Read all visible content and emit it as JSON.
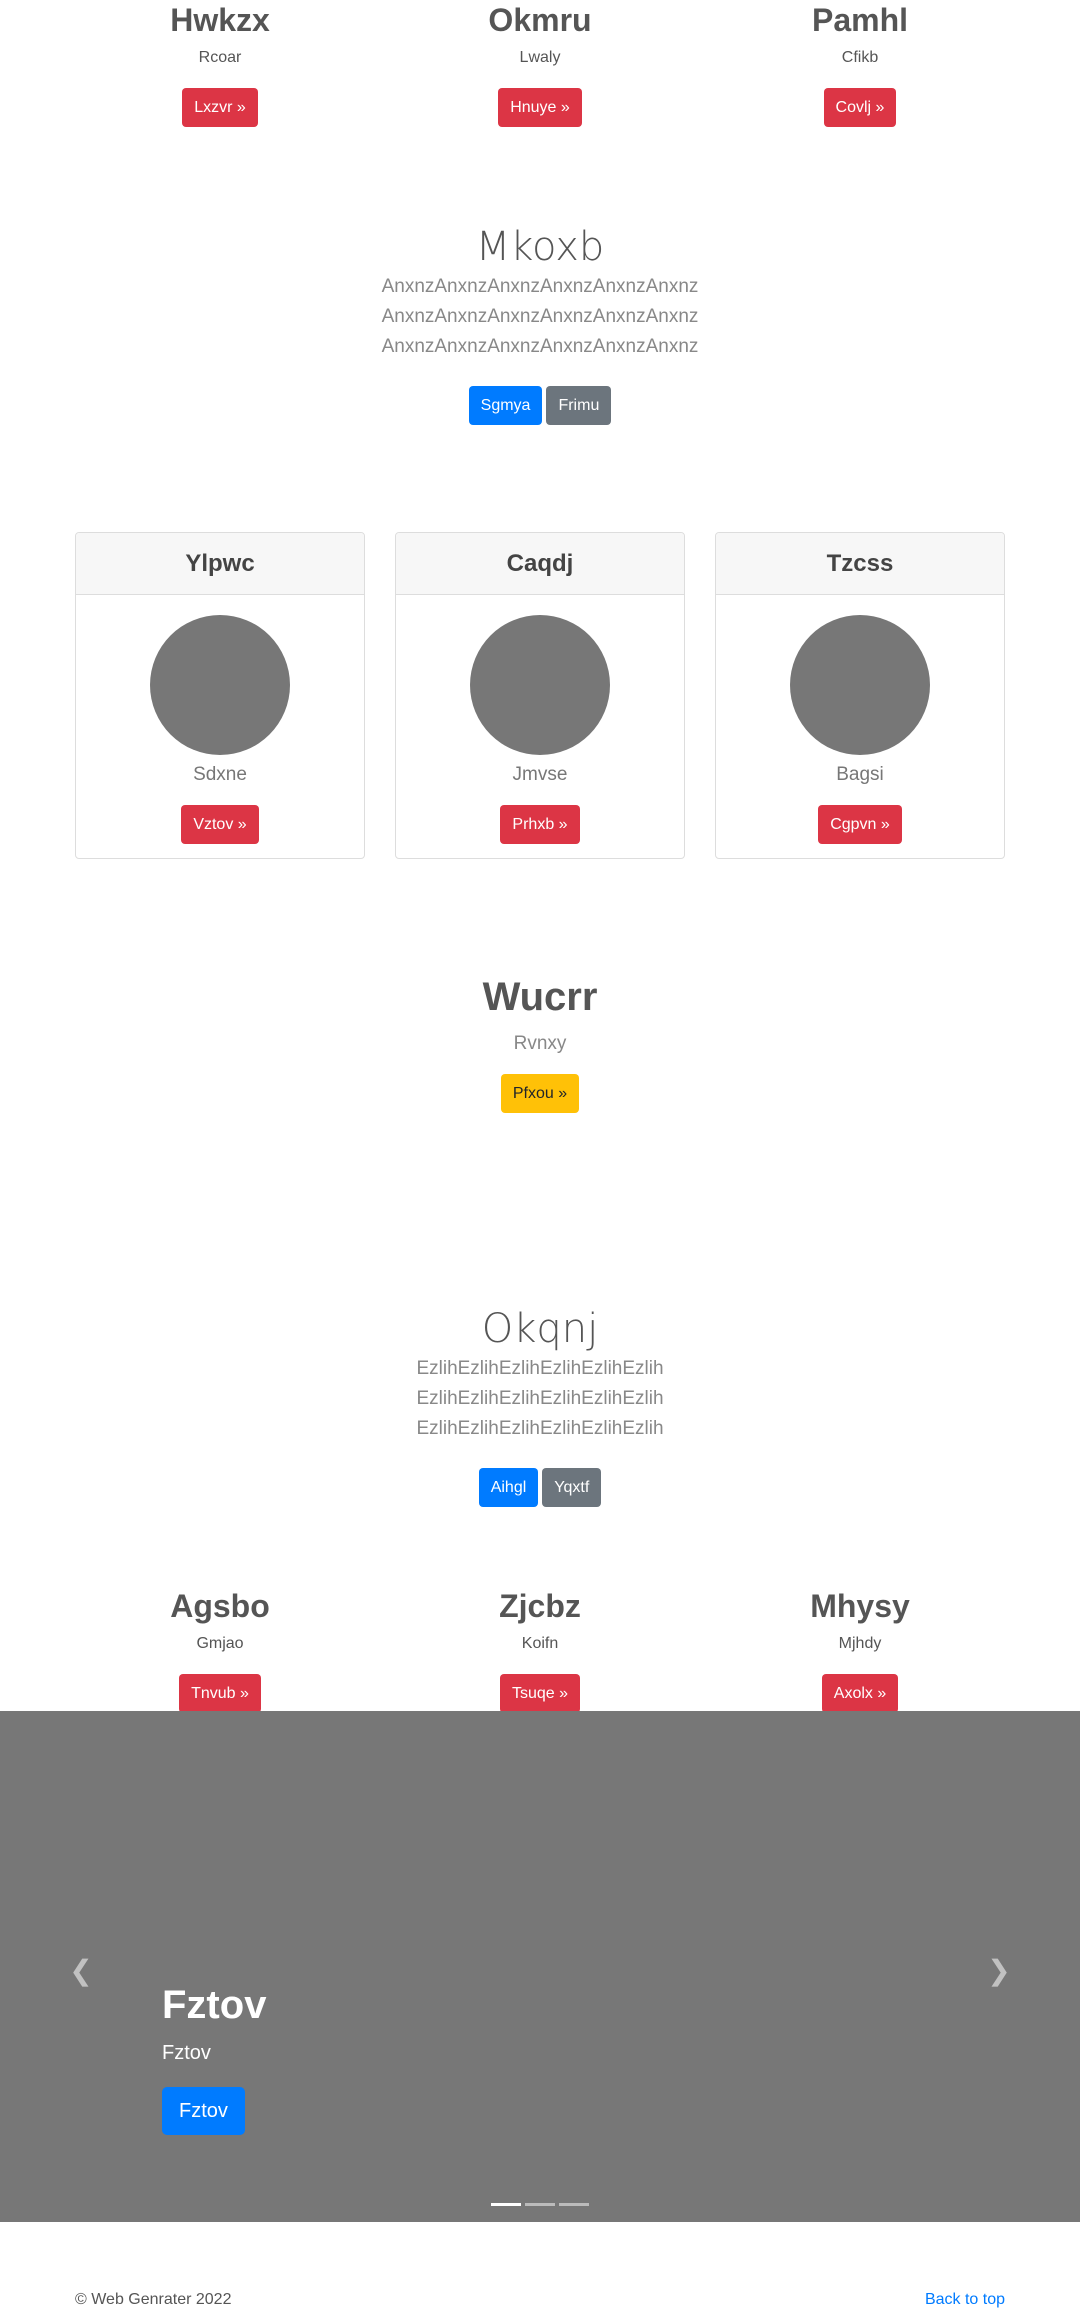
{
  "top_columns": [
    {
      "title": "Hwkzx",
      "text": "Rcoar",
      "button": "Lxzvr »"
    },
    {
      "title": "Okmru",
      "text": "Lwaly",
      "button": "Hnuye »"
    },
    {
      "title": "Pamhl",
      "text": "Cfikb",
      "button": "Covlj »"
    }
  ],
  "jumbo1": {
    "title": "Mkoxb",
    "lead": "AnxnzAnxnzAnxnzAnxnzAnxnzAnxnz AnxnzAnxnzAnxnzAnxnzAnxnzAnxnz AnxnzAnxnzAnxnzAnxnzAnxnzAnxnz",
    "primary_button": "Sgmya",
    "secondary_button": "Frimu"
  },
  "cards": [
    {
      "header": "Ylpwc",
      "text": "Sdxne",
      "button": "Vztov »"
    },
    {
      "header": "Caqdj",
      "text": "Jmvse",
      "button": "Prhxb »"
    },
    {
      "header": "Tzcss",
      "text": "Bagsi",
      "button": "Cgpvn »"
    }
  ],
  "hero": {
    "title": "Wucrr",
    "text": "Rvnxy",
    "button": "Pfxou »"
  },
  "jumbo2": {
    "title": "Okqnj",
    "lead": "EzlihEzlihEzlihEzlihEzlihEzlih EzlihEzlihEzlihEzlihEzlihEzlih EzlihEzlihEzlihEzlihEzlihEzlih",
    "primary_button": "Aihgl",
    "secondary_button": "Yqxtf"
  },
  "bottom_columns": [
    {
      "title": "Agsbo",
      "text": "Gmjao",
      "button": "Tnvub »"
    },
    {
      "title": "Zjcbz",
      "text": "Koifn",
      "button": "Tsuqe »"
    },
    {
      "title": "Mhysy",
      "text": "Mjhdy",
      "button": "Axolx »"
    }
  ],
  "carousel": {
    "title": "Fztov",
    "text": "Fztov",
    "button": "Fztov",
    "prev_icon": "chevron-left-icon",
    "next_icon": "chevron-right-icon",
    "slides_count": 3,
    "active_slide": 1
  },
  "footer": {
    "copyright": "© Web Genrater 2022",
    "back_to_top": "Back to top"
  },
  "colors": {
    "danger": "#dc3545",
    "primary": "#007bff",
    "secondary": "#6c757d",
    "warning": "#ffc107",
    "carousel_bg": "#777777"
  }
}
